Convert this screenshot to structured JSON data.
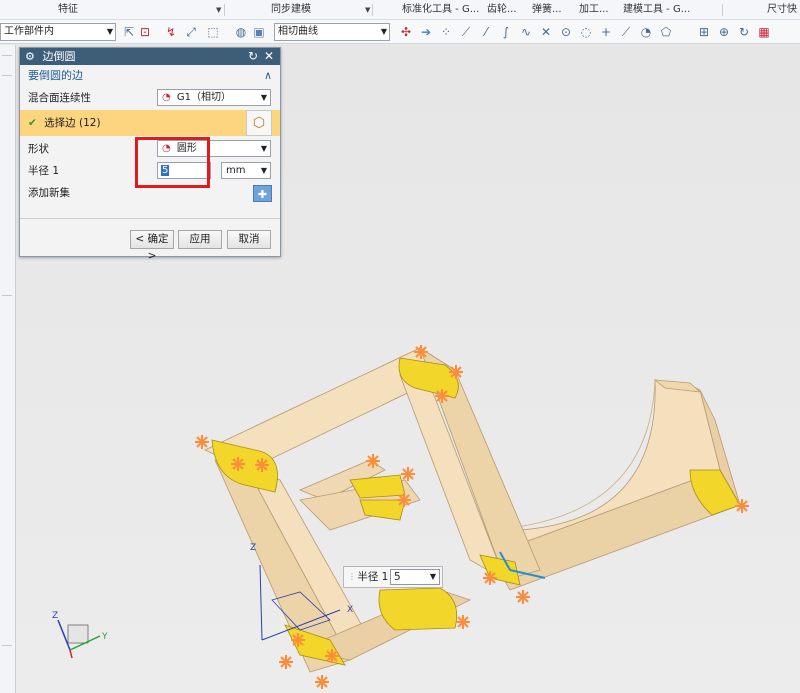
{
  "ribbon": {
    "groups": [
      "特征",
      "同步建模",
      "标准化工具 - G...",
      "齿轮...",
      "弹簧...",
      "加工...",
      "建模工具 - G...",
      "尺寸快"
    ]
  },
  "toolbar": {
    "scope_combo": "工作部件内",
    "curve_combo": "相切曲线"
  },
  "dialog": {
    "title": "边倒圆",
    "section": "要倒圆的边",
    "continuity_label": "混合面连续性",
    "continuity_value": "G1（相切）",
    "select_edge": "选择边 (12)",
    "shape_label": "形状",
    "shape_value": "圆形",
    "radius_label": "半径 1",
    "radius_value": "5",
    "radius_unit": "mm",
    "add_set_label": "添加新集",
    "ok_button": "< 确定 >",
    "apply_button": "应用",
    "cancel_button": "取消"
  },
  "float_input": {
    "label": "半径 1",
    "value": "5"
  },
  "axis_labels": {
    "z": "Z",
    "y": "Y",
    "x": "X"
  },
  "colors": {
    "accent": "#3d5e7b",
    "selected_row": "#fdd57e",
    "highlight": "#e01b1b",
    "model_body": "#f2dcb5",
    "fillet": "#f1d400",
    "handle": "#ff8c3a"
  }
}
